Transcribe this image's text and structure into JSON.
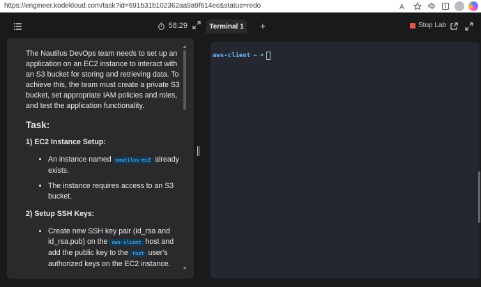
{
  "browser": {
    "url": "https://engineer.kodekloud.com/task?id=691b31b102362aa9a9f614ec&status=redo",
    "icons": [
      "read-aloud-icon",
      "star-icon",
      "extensions-icon",
      "favorites-icon",
      "avatar",
      "copilot-icon"
    ]
  },
  "left_header": {
    "timer": "58:29"
  },
  "task": {
    "intro": "The Nautilus DevOps team needs to set up an application on an EC2 instance to interact with an S3 bucket for storing and retrieving data. To achieve this, the team must create a private S3 bucket, set appropriate IAM policies and roles, and test the application functionality.",
    "heading": "Task:",
    "section1": "1) EC2 Instance Setup:",
    "s1_b1_pre": "An instance named ",
    "s1_b1_code": "nautilus-ec2",
    "s1_b1_post": " already exists.",
    "s1_b2": "The instance requires access to an S3 bucket.",
    "section2": "2) Setup SSH Keys:",
    "s2_b1_pre": "Create new SSH key pair (id_rsa and id_rsa.pub) on the ",
    "s2_b1_code": "aws-client",
    "s2_b1_mid": " host and add the public key to the ",
    "s2_b1_code2": "root",
    "s2_b1_post": " user's authorized keys on",
    "s2_b1_cut": "the EC2 instance."
  },
  "right_header": {
    "tab_label": "Terminal 1",
    "add_label": "+",
    "stop_label": "Stop Lab"
  },
  "terminal": {
    "host": "aws-client",
    "path": "~",
    "arrow": "➜"
  }
}
